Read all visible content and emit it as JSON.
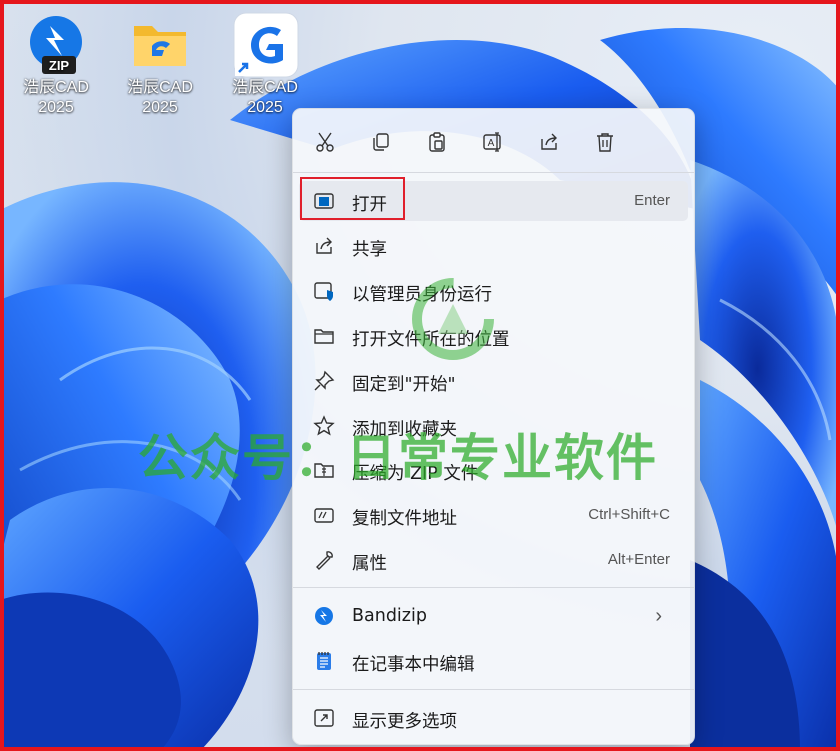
{
  "desktop": {
    "icons": [
      {
        "name": "浩辰CAD",
        "year": "2025",
        "type": "zip-icon"
      },
      {
        "name": "浩辰CAD",
        "year": "2025",
        "type": "folder-icon"
      },
      {
        "name": "浩辰CAD",
        "year": "2025",
        "type": "gstarcad-shortcut-icon"
      }
    ]
  },
  "context_menu": {
    "toolbar": [
      "cut-icon",
      "copy-icon",
      "paste-icon",
      "rename-icon",
      "share-icon",
      "delete-icon"
    ],
    "items": [
      {
        "label": "打开",
        "shortcut": "Enter",
        "icon": "open-window-icon"
      },
      {
        "label": "共享",
        "shortcut": "",
        "icon": "share-icon"
      },
      {
        "label": "以管理员身份运行",
        "shortcut": "",
        "icon": "admin-shield-icon"
      },
      {
        "label": "打开文件所在的位置",
        "shortcut": "",
        "icon": "folder-icon"
      },
      {
        "label": "固定到\"开始\"",
        "shortcut": "",
        "icon": "pin-icon"
      },
      {
        "label": "添加到收藏夹",
        "shortcut": "",
        "icon": "star-icon"
      },
      {
        "label": "压缩为 ZIP 文件",
        "shortcut": "",
        "icon": "zip-folder-icon"
      },
      {
        "label": "复制文件地址",
        "shortcut": "Ctrl+Shift+C",
        "icon": "copy-path-icon"
      },
      {
        "label": "属性",
        "shortcut": "Alt+Enter",
        "icon": "wrench-icon"
      },
      {
        "label": "Bandizip",
        "shortcut": "",
        "icon": "bandizip-icon"
      },
      {
        "label": "在记事本中编辑",
        "shortcut": "",
        "icon": "notepad-icon"
      },
      {
        "label": "显示更多选项",
        "shortcut": "",
        "icon": "more-options-icon"
      }
    ]
  },
  "watermark": {
    "text": "公众号：日常专业软件"
  },
  "colors": {
    "accent": "#0067c0",
    "highlight_border": "#e01f2b",
    "watermark": "#2baa28",
    "frame": "#e5161c"
  }
}
